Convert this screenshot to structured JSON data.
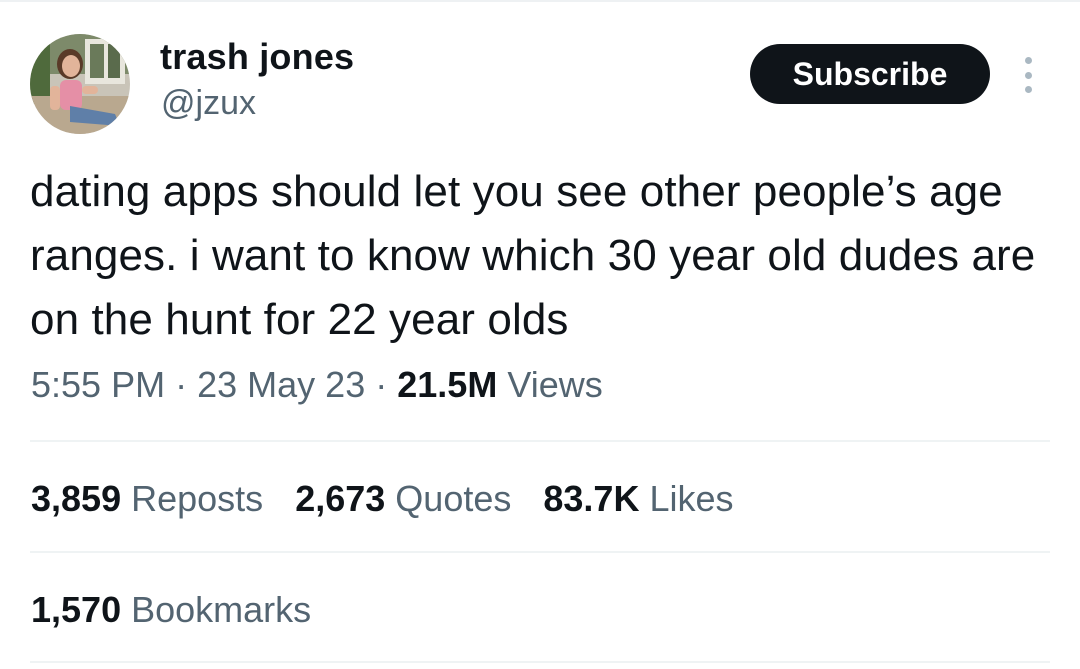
{
  "author": {
    "name": "trash jones",
    "handle": "@jzux"
  },
  "subscribe_label": "Subscribe",
  "tweet": {
    "text": "dating apps should let you see other people’s age ranges. i want to know which 30 year old dudes are on the hunt for 22 year olds"
  },
  "meta": {
    "time": "5:55 PM",
    "separator": "·",
    "date": "23 May 23",
    "views_count": "21.5M",
    "views_label": "Views"
  },
  "stats": {
    "reposts_count": "3,859",
    "reposts_label": "Reposts",
    "quotes_count": "2,673",
    "quotes_label": "Quotes",
    "likes_count": "83.7K",
    "likes_label": "Likes",
    "bookmarks_count": "1,570",
    "bookmarks_label": "Bookmarks"
  },
  "icons": {
    "more": "more-vertical-icon"
  },
  "colors": {
    "text_primary": "#0f1419",
    "text_secondary": "#536471",
    "button_bg": "#0f1419",
    "button_text": "#ffffff",
    "divider": "#eff3f4"
  }
}
